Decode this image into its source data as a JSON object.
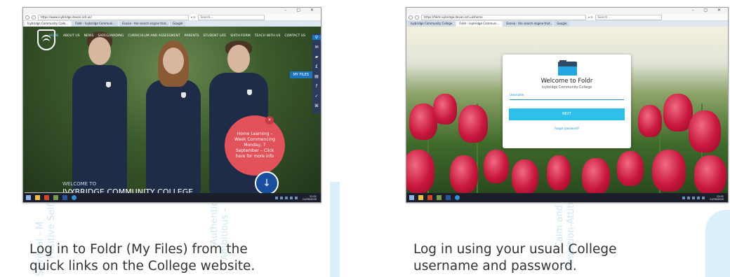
{
  "background": {
    "left_words": [
      "Spiritual - M",
      "Positive Self -"
    ],
    "middle_words": [
      "Authentic",
      "Ambitious -"
    ],
    "right_words": [
      "Calm and F",
      "Ambition-Attitude"
    ]
  },
  "shot_left": {
    "url": "https://www.ivybridge.devon.sch.uk/",
    "search_placeholder": "Search...",
    "tabs": [
      "Ivybridge Community Colle...",
      "Foldr - Ivybridge Communi...",
      "Ecosia - the search engine that...",
      "Google"
    ],
    "nav": [
      "HOME",
      "ABOUT US",
      "NEWS",
      "SAFEGUARDING",
      "CURRICULUM AND ASSESSMENT",
      "PARENTS",
      "STUDENT LIFE",
      "SIXTH FORM",
      "TEACH WITH US",
      "CONTACT US"
    ],
    "my_files_label": "MY FILES",
    "promo_text": "Home Learning – Week Commencing Monday, 7 September – Click here for more info",
    "promo_close": "×",
    "down_arrow": "↓",
    "welcome": "WELCOME TO",
    "college_name": "IVYBRIDGE COMMUNITY COLLEGE",
    "status_url": "https://foldr.ivybridge.devon.sch.uk",
    "clock_time": "12:01",
    "clock_date": "11/09/2020"
  },
  "shot_right": {
    "url": "https://foldr.ivybridge.devon.sch.uk/home",
    "search_placeholder": "Search...",
    "tabs": [
      "Ivybridge Community College",
      "Foldr - Ivybridge Communi...",
      "Ecosia - the search engine that...",
      "Google"
    ],
    "card": {
      "title": "Welcome to Foldr",
      "subtitle": "Ivybridge Community College",
      "username_label": "Username",
      "next_label": "NEXT",
      "forgot_label": "Forgot password?"
    },
    "clock_time": "12:01",
    "clock_date": "11/09/2020"
  },
  "captions": {
    "left_line1": "Log in to Foldr (My Files) from the",
    "left_line2": "quick links on the College website.",
    "right_line1": "Log in using your usual College",
    "right_line2": "username and password."
  },
  "colors": {
    "accent_blue": "#1e73be",
    "next_button": "#2ec0ea",
    "promo_red": "#e2525b",
    "caption_text": "#333333"
  }
}
